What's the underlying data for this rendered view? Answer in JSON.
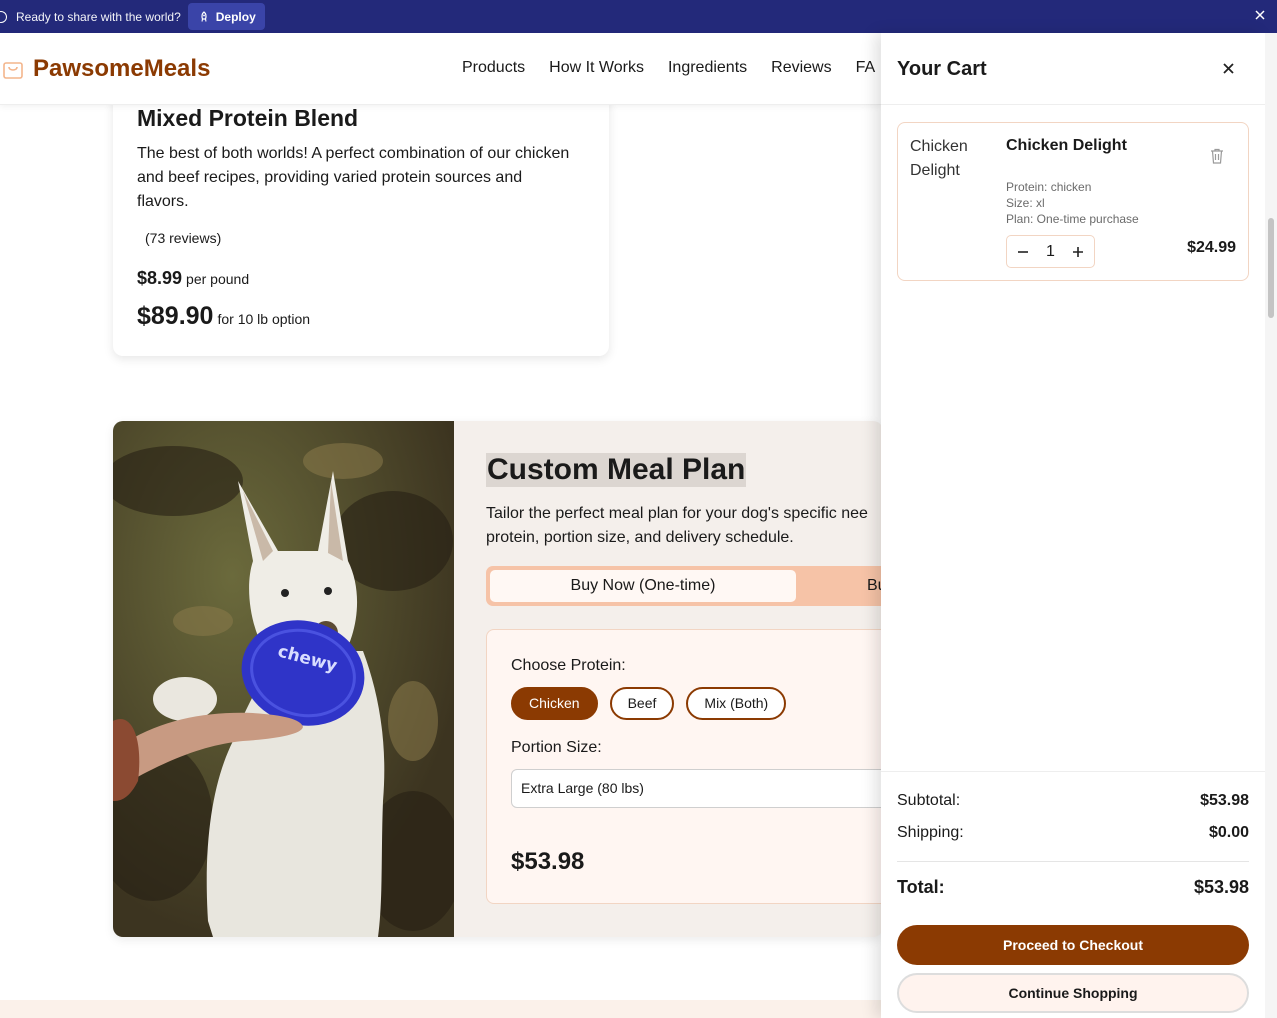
{
  "banner": {
    "message": "Ready to share with the world?",
    "deploy_label": "Deploy"
  },
  "header": {
    "brand": "PawsomeMeals",
    "nav": [
      "Products",
      "How It Works",
      "Ingredients",
      "Reviews",
      "FA"
    ]
  },
  "product_card": {
    "title": "Mixed Protein Blend",
    "description": "The best of both worlds! A perfect combination of our chicken and beef recipes, providing varied protein sources and flavors.",
    "reviews": "(73 reviews)",
    "price_per_pound": "$8.99",
    "price_per_pound_unit": "per pound",
    "option_price": "$89.90",
    "option_label": "for 10 lb option"
  },
  "meal_plan": {
    "title": "Custom Meal Plan",
    "description_line1": "Tailor the perfect meal plan for your dog's specific nee",
    "description_line2": "protein, portion size, and delivery schedule.",
    "tab_active": "Buy Now (One-time)",
    "tab_other": "Bu",
    "protein_label": "Choose Protein:",
    "proteins": [
      "Chicken",
      "Beef",
      "Mix (Both)"
    ],
    "selected_protein": "Chicken",
    "portion_label": "Portion Size:",
    "portion_value": "Extra Large (80 lbs)",
    "price": "$53.98"
  },
  "cart": {
    "title": "Your Cart",
    "item": {
      "image_alt": "Chicken Delight",
      "name": "Chicken Delight",
      "protein": "Protein: chicken",
      "size": "Size: xl",
      "plan": "Plan: One-time purchase",
      "quantity": "1",
      "price": "$24.99"
    },
    "subtotal_label": "Subtotal:",
    "subtotal_value": "$53.98",
    "shipping_label": "Shipping:",
    "shipping_value": "$0.00",
    "total_label": "Total:",
    "total_value": "$53.98",
    "checkout_label": "Proceed to Checkout",
    "continue_label": "Continue Shopping"
  },
  "colors": {
    "banner": "#23297a",
    "brand": "#8b3a02",
    "tab_bg": "#f6c3a7",
    "form_bg": "#fff6f2"
  }
}
